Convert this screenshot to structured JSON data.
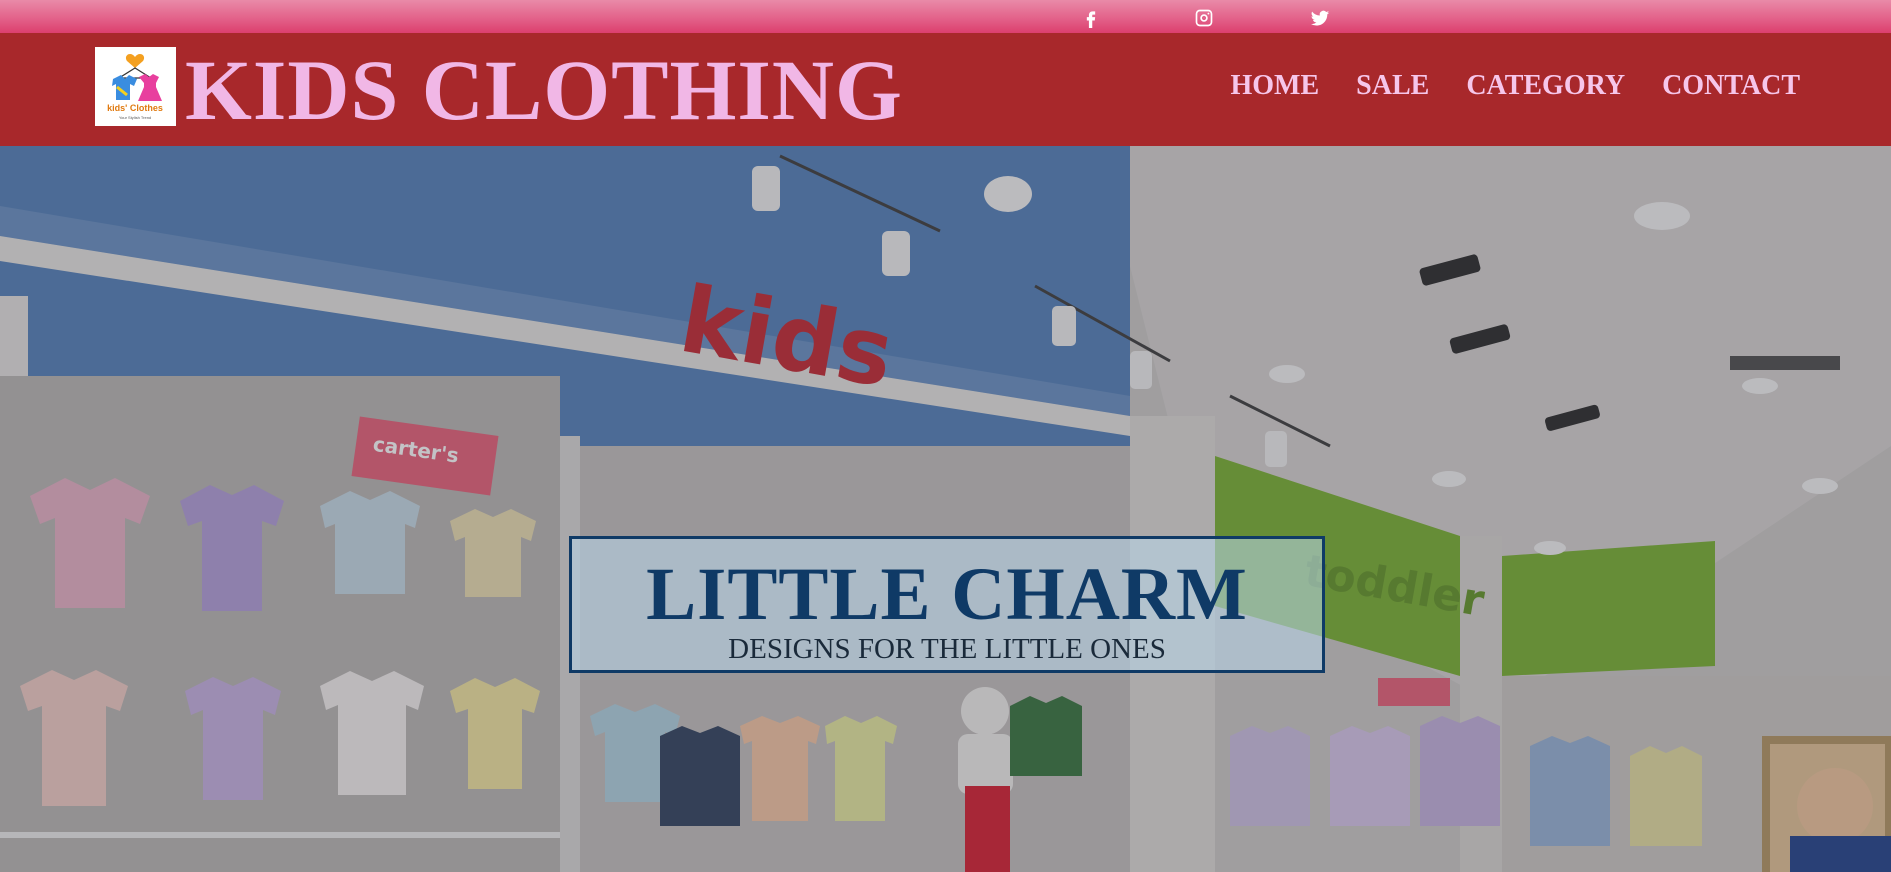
{
  "topbar": {
    "social": [
      {
        "name": "facebook-icon"
      },
      {
        "name": "instagram-icon"
      },
      {
        "name": "twitter-icon"
      }
    ]
  },
  "header": {
    "logo": {
      "brand_text": "kids' Clothes",
      "tagline": "Your Stylish Trend"
    },
    "title": "KIDS CLOTHING",
    "nav": [
      "HOME",
      "SALE",
      "CATEGORY",
      "CONTACT"
    ]
  },
  "hero": {
    "headline": "LITTLE CHARM",
    "subheadline": "DESIGNS FOR THE LITTLE ONES",
    "scene_signs": {
      "kids_wall": "kids",
      "toddler_wall": "toddler",
      "brand_sign": "carter's"
    }
  },
  "colors": {
    "topbar": "#e3628a",
    "header": "#a8282b",
    "title": "#f1b7e6",
    "nav": "#f6c6ea",
    "accent_navy": "#0f3a66"
  }
}
